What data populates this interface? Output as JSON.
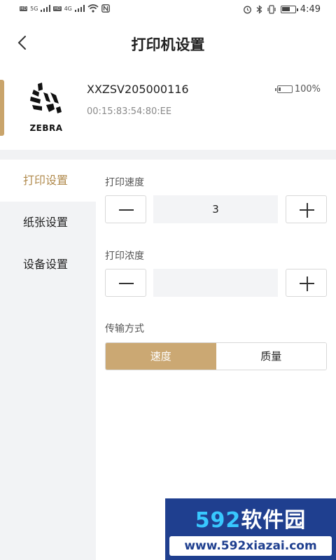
{
  "status_bar": {
    "time": "4:49",
    "sim1": "HD",
    "sim2": "HD",
    "net1": "5G",
    "net2": "4G"
  },
  "header": {
    "title": "打印机设置"
  },
  "device": {
    "brand": "ZEBRA",
    "name": "XXZSV205000116",
    "mac": "00:15:83:54:80:EE",
    "battery": "100%"
  },
  "sidebar": {
    "items": [
      {
        "label": "打印设置",
        "active": true
      },
      {
        "label": "纸张设置",
        "active": false
      },
      {
        "label": "设备设置",
        "active": false
      }
    ]
  },
  "print_settings": {
    "speed_label": "打印速度",
    "speed_value": "3",
    "density_label": "打印浓度",
    "density_value": "",
    "transfer_label": "传输方式",
    "transfer_options": [
      "速度",
      "质量"
    ],
    "transfer_selected": "速度"
  },
  "watermark": {
    "brand_num": "592",
    "brand_text": "软件园",
    "url": "www.592xiazai.com"
  },
  "colors": {
    "accent": "#c9a46b",
    "selected_fill": "#cba873",
    "sidebar_bg": "#f2f3f5"
  }
}
